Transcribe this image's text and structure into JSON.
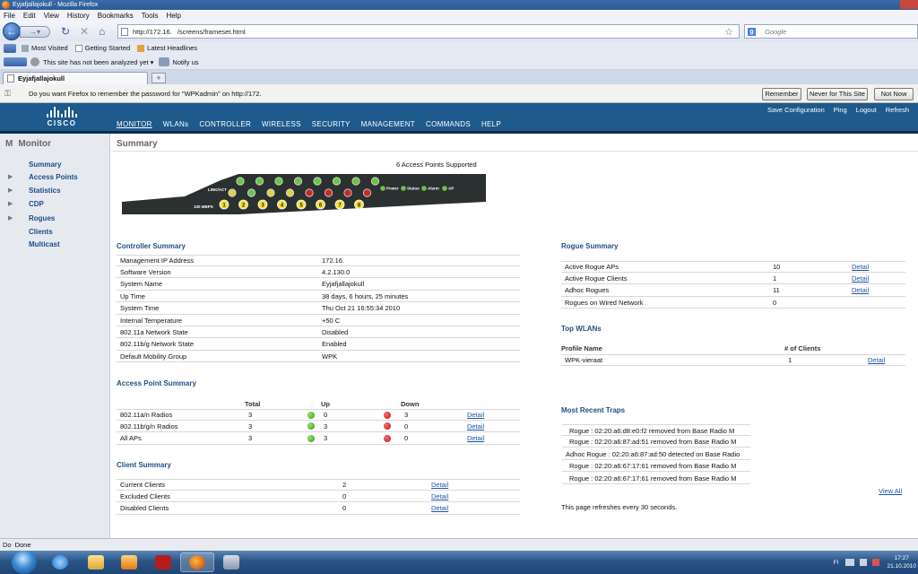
{
  "window": {
    "title": "Eyjafjallajokull - Mozilla Firefox"
  },
  "menu": [
    "File",
    "Edit",
    "View",
    "History",
    "Bookmarks",
    "Tools",
    "Help"
  ],
  "nav": {
    "url": "http://172.16.    /screens/frameset.html",
    "search_placeholder": "Google"
  },
  "bookmarks": [
    "Most Visited",
    "Getting Started",
    "Latest Headlines"
  ],
  "addon": {
    "wot_text": "This site has not been analyzed yet",
    "notify": "Notify us"
  },
  "tab": {
    "label": "Eyjafjallajokull",
    "new_tab": "+"
  },
  "notification": {
    "text": "Do you want Firefox to remember the password for \"WPKadmin\" on http://172.",
    "remember": "Remember",
    "never": "Never for This Site",
    "not_now": "Not Now"
  },
  "cisco": {
    "logo": "CISCO",
    "menu": [
      "MONITOR",
      "WLANs",
      "CONTROLLER",
      "WIRELESS",
      "SECURITY",
      "MANAGEMENT",
      "COMMANDS",
      "HELP"
    ],
    "links": [
      "Save Configuration",
      "Ping",
      "Logout",
      "Refresh"
    ]
  },
  "sidebar": {
    "letter": "M",
    "title": "Monitor",
    "items": [
      {
        "label": "Summary",
        "arrow": false
      },
      {
        "label": "Access Points",
        "arrow": true
      },
      {
        "label": "Statistics",
        "arrow": true
      },
      {
        "label": "CDP",
        "arrow": true
      },
      {
        "label": "Rogues",
        "arrow": true
      },
      {
        "label": "Clients",
        "arrow": false
      },
      {
        "label": "Multicast",
        "arrow": false
      }
    ]
  },
  "summary": {
    "title": "Summary",
    "ap_supported": "6 Access Points Supported",
    "panel": {
      "link_label": "LINK/ACT",
      "speed_label": "100 MBPS",
      "ports": [
        "1",
        "2",
        "3",
        "4",
        "5",
        "6",
        "7",
        "8"
      ],
      "legend": [
        "Power",
        "Status",
        "Alarm",
        "AP"
      ]
    }
  },
  "controller": {
    "title": "Controller Summary",
    "rows": [
      [
        "Management IP Address",
        "172.16."
      ],
      [
        "Software Version",
        "4.2.130.0"
      ],
      [
        "System Name",
        "Eyjafjallajokull"
      ],
      [
        "Up Time",
        "38 days, 6 hours, 25 minutes"
      ],
      [
        "System Time",
        "Thu Oct 21 16:55:34 2010"
      ],
      [
        "Internal Temperature",
        "+50 C"
      ],
      [
        "802.11a Network State",
        "Disabled"
      ],
      [
        "802.11b/g Network State",
        "Enabled"
      ],
      [
        "Default Mobility Group",
        "WPK"
      ]
    ]
  },
  "ap_summary": {
    "title": "Access Point Summary",
    "headers": [
      "Total",
      "Up",
      "Down"
    ],
    "rows": [
      {
        "name": "802.11a/n Radios",
        "total": "3",
        "up": "0",
        "down": "3",
        "link": "Detail"
      },
      {
        "name": "802.11b/g/n Radios",
        "total": "3",
        "up": "3",
        "down": "0",
        "link": "Detail"
      },
      {
        "name": "All APs",
        "total": "3",
        "up": "3",
        "down": "0",
        "link": "Detail"
      }
    ]
  },
  "client_summary": {
    "title": "Client Summary",
    "rows": [
      {
        "name": "Current Clients",
        "value": "2",
        "link": "Detail"
      },
      {
        "name": "Excluded Clients",
        "value": "0",
        "link": "Detail"
      },
      {
        "name": "Disabled Clients",
        "value": "0",
        "link": "Detail"
      }
    ]
  },
  "rogue_summary": {
    "title": "Rogue Summary",
    "rows": [
      {
        "name": "Active Rogue APs",
        "value": "10",
        "link": "Detail"
      },
      {
        "name": "Active Rogue Clients",
        "value": "1",
        "link": "Detail"
      },
      {
        "name": "Adhoc Rogues",
        "value": "11",
        "link": "Detail"
      },
      {
        "name": "Rogues on Wired Network",
        "value": "0",
        "link": ""
      }
    ]
  },
  "top_wlans": {
    "title": "Top WLANs",
    "headers": [
      "Profile Name",
      "# of Clients"
    ],
    "rows": [
      {
        "name": "WPK-vieraat",
        "clients": "1",
        "link": "Detail"
      }
    ]
  },
  "traps": {
    "title": "Most Recent Traps",
    "rows": [
      "Rogue : 02:20:a6:d8:e0:f2  removed from Base Radio M",
      "Rogue : 02:20:a6:87:ad:51  removed from Base Radio M",
      "Adhoc Rogue : 02:20:a6:87:ad:50 detected on Base Radio",
      "Rogue : 02:20:a6:67:17:61  removed from Base Radio M",
      "Rogue : 02:20:a6:67:17:61  removed from Base Radio M"
    ],
    "view_all": "View All",
    "refresh_note": "This page refreshes every 30 seconds."
  },
  "status": {
    "text": "Done",
    "prefix": "Do"
  },
  "taskbar": {
    "lang": "FI",
    "time": "17:27",
    "date": "21.10.2010"
  }
}
